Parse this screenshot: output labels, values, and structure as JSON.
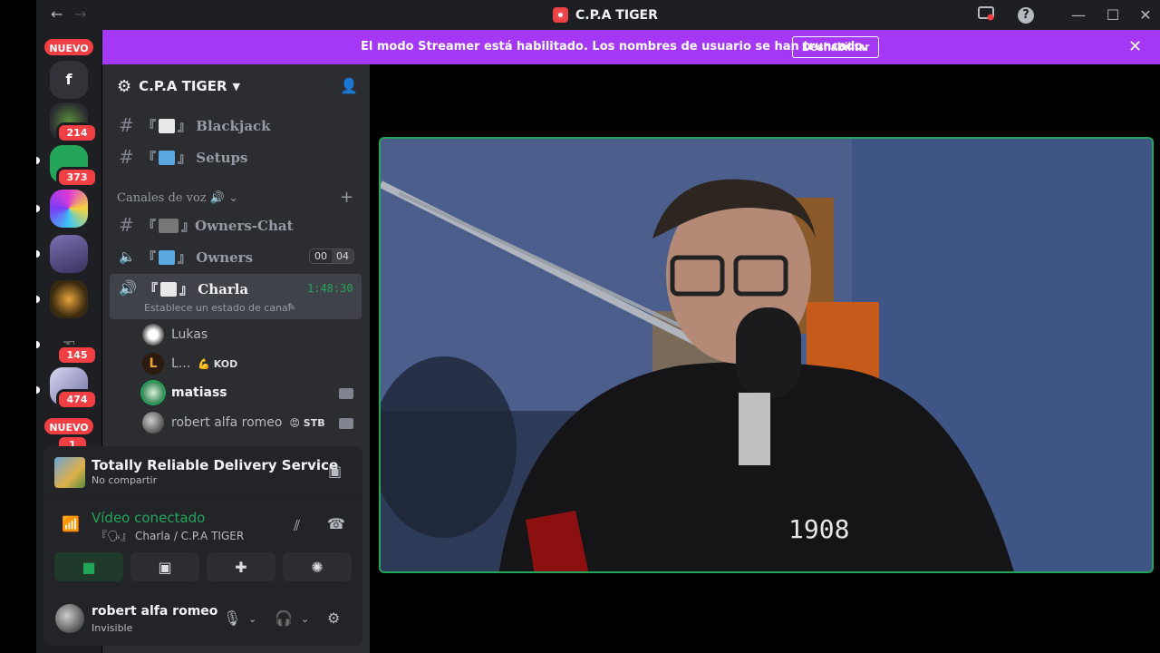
{
  "titlebar": {
    "title": "C.P.A TIGER",
    "back": "←",
    "forward": "→",
    "help": "?"
  },
  "streamer_bar": {
    "message": "El modo Streamer está habilitado. Los nombres de usuario se han truncado.",
    "button": "Deshabilitar"
  },
  "rail": {
    "badges": [
      "NUEVO",
      "214",
      "373",
      "145",
      "474",
      "NUEVO",
      "1"
    ],
    "f_server": "f"
  },
  "guild": {
    "name": "C.P.A TIGER"
  },
  "channels": {
    "text": [
      {
        "bracket_l": "『",
        "bracket_r": "』",
        "name": "Blackjack"
      },
      {
        "bracket_l": "『",
        "bracket_r": "』",
        "name": "Setups"
      }
    ],
    "voice_category": "Canales de voz",
    "voice": [
      {
        "name": "Owners-Chat"
      },
      {
        "name": "Owners",
        "count_a": "00",
        "count_b": "04"
      },
      {
        "name": "Charla",
        "timer": "1:48:30",
        "status": "Establece un estado de canal"
      }
    ]
  },
  "voice_users": [
    {
      "name": "Lukas",
      "tag": ""
    },
    {
      "name": "L...",
      "tag": "KOD"
    },
    {
      "name": "matiass",
      "tag": ""
    },
    {
      "name": "robert alfa romeo",
      "tag": "STB"
    }
  ],
  "activity": {
    "title": "Totally Reliable Delivery Service",
    "subtitle": "No compartir"
  },
  "rtc": {
    "status": "Vídeo conectado",
    "channel": "『🗣』 Charla / C.P.A TIGER"
  },
  "me": {
    "name": "robert alfa romeo",
    "status": "Invisible"
  },
  "colors": {
    "accent": "#a438f6",
    "green": "#23a55a",
    "red": "#f23f43"
  }
}
